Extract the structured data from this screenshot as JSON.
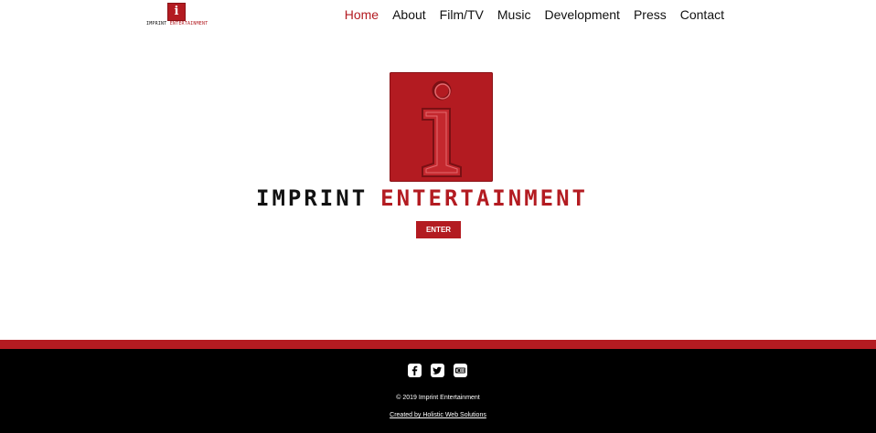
{
  "brand": {
    "logo_letter": "i",
    "logo_text_left": "IMPRINT",
    "logo_text_right": "ENTERTAINMENT",
    "accent": "#b31b21"
  },
  "nav": {
    "items": [
      {
        "label": "Home",
        "active": true
      },
      {
        "label": "About"
      },
      {
        "label": "Film/TV"
      },
      {
        "label": "Music"
      },
      {
        "label": "Development"
      },
      {
        "label": "Press"
      },
      {
        "label": "Contact"
      }
    ]
  },
  "hero": {
    "title_left": "IMPRINT",
    "title_right": "ENTERTAINMENT",
    "enter_label": "ENTER"
  },
  "footer": {
    "social": [
      "facebook-icon",
      "twitter-icon",
      "imdb-icon"
    ],
    "copyright": "© 2019 Imprint Entertainment",
    "credit": "Created by Holistic Web Solutions"
  }
}
